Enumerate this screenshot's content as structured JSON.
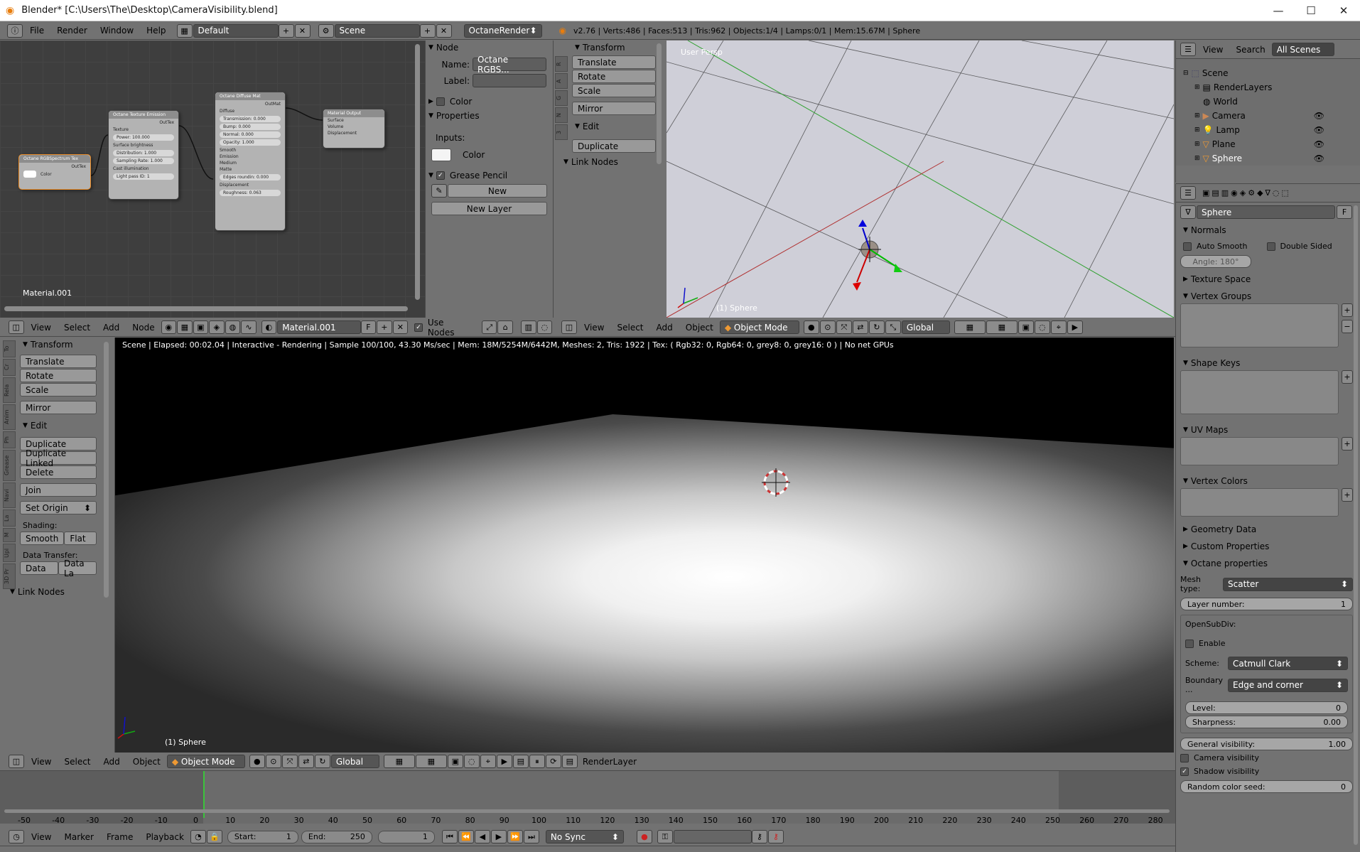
{
  "window": {
    "title": "Blender* [C:\\Users\\The\\Desktop\\CameraVisibility.blend]",
    "minimize": "—",
    "maximize": "☐",
    "close": "✕"
  },
  "info_bar": {
    "menus": [
      "File",
      "Render",
      "Window",
      "Help"
    ],
    "layout": "Default",
    "scene": "Scene",
    "engine": "OctaneRender",
    "stats": "v2.76 | Verts:486 | Faces:513 | Tris:962 | Objects:1/4 | Lamps:0/1 | Mem:15.67M | Sphere"
  },
  "node_editor": {
    "material_label": "Material.001",
    "nodes": {
      "rgb": {
        "title": "Octane RGBSpectrum Tex",
        "out": "OutTex",
        "color": "Color"
      },
      "emission": {
        "title": "Octane Texture Emission",
        "out": "OutTex",
        "rows": [
          "Texture",
          "Power: 100.000",
          "Surface brightness",
          "Distribution: 1.000",
          "Sampling Rate: 1.000",
          "Cast illumination",
          "Light pass ID: 1"
        ]
      },
      "diffuse": {
        "title": "Octane Diffuse Mat",
        "out": "OutMat",
        "rows": [
          "Diffuse",
          "Transmission: 0.000",
          "Bump: 0.000",
          "Normal: 0.000",
          "Opacity: 1.000",
          "Smooth",
          "Emission",
          "Medium",
          "Matte",
          "Edges roundin: 0.000",
          "Displacement",
          "Roughness: 0.063"
        ]
      },
      "output": {
        "title": "Material Output",
        "rows": [
          "Surface",
          "Volume",
          "Displacement"
        ]
      }
    },
    "header": {
      "menus": [
        "View",
        "Select",
        "Add",
        "Node"
      ],
      "material": "Material.001",
      "fake_user": "F",
      "use_nodes": "Use Nodes"
    }
  },
  "node_props": {
    "node_title": "Node",
    "name_label": "Name:",
    "name_value": "Octane RGBS...",
    "label_label": "Label:",
    "color_section": "Color",
    "properties_section": "Properties",
    "inputs_label": "Inputs:",
    "color_input": "Color",
    "grease_pencil": "Grease Pencil",
    "new_button": "New",
    "new_layer_button": "New Layer"
  },
  "mini_tools": {
    "transform": "Transform",
    "buttons": [
      "Translate",
      "Rotate",
      "Scale"
    ],
    "mirror": "Mirror",
    "edit": "Edit",
    "duplicate": "Duplicate",
    "link_nodes": "Link Nodes",
    "tabs": [
      "R",
      "A",
      "G",
      "N",
      "3"
    ]
  },
  "viewport_top": {
    "label": "User Persp",
    "object": "(1) Sphere",
    "header": {
      "menus": [
        "View",
        "Select",
        "Add",
        "Object"
      ],
      "mode": "Object Mode",
      "orientation": "Global"
    }
  },
  "outliner": {
    "header": {
      "view": "View",
      "search": "Search",
      "scenes": "All Scenes"
    },
    "items": [
      {
        "label": "Scene",
        "depth": 0
      },
      {
        "label": "RenderLayers",
        "depth": 1
      },
      {
        "label": "World",
        "depth": 1
      },
      {
        "label": "Camera",
        "depth": 1
      },
      {
        "label": "Lamp",
        "depth": 1
      },
      {
        "label": "Plane",
        "depth": 1
      },
      {
        "label": "Sphere",
        "depth": 1
      }
    ]
  },
  "properties": {
    "object_name": "Sphere",
    "fake": "F",
    "normals": {
      "title": "Normals",
      "auto_smooth": "Auto Smooth",
      "double_sided": "Double Sided",
      "angle": "Angle: 180°"
    },
    "sections": {
      "texture_space": "Texture Space",
      "vertex_groups": "Vertex Groups",
      "shape_keys": "Shape Keys",
      "uv_maps": "UV Maps",
      "vertex_colors": "Vertex Colors",
      "geometry_data": "Geometry Data",
      "custom_properties": "Custom Properties",
      "octane_properties": "Octane properties"
    },
    "octane": {
      "mesh_type_label": "Mesh type:",
      "mesh_type": "Scatter",
      "layer_label": "Layer number:",
      "layer_value": "1",
      "opensubdiv": "OpenSubDiv:",
      "enable": "Enable",
      "scheme_label": "Scheme:",
      "scheme": "Catmull Clark",
      "boundary_label": "Boundary ...",
      "boundary": "Edge and corner",
      "level_label": "Level:",
      "level_value": "0",
      "sharpness_label": "Sharpness:",
      "sharpness_value": "0.00",
      "gen_vis_label": "General visibility:",
      "gen_vis_value": "1.00",
      "camera_vis": "Camera visibility",
      "shadow_vis": "Shadow visibility",
      "seed_label": "Random color seed:",
      "seed_value": "0"
    }
  },
  "tool_shelf": {
    "transform": "Transform",
    "translate": "Translate",
    "rotate": "Rotate",
    "scale": "Scale",
    "mirror": "Mirror",
    "edit": "Edit",
    "duplicate": "Duplicate",
    "duplicate_linked": "Duplicate Linked",
    "delete": "Delete",
    "join": "Join",
    "set_origin": "Set Origin",
    "shading": "Shading:",
    "smooth": "Smooth",
    "flat": "Flat",
    "data_transfer": "Data Transfer:",
    "data": "Data",
    "data_la": "Data La",
    "link_nodes": "Link Nodes",
    "tabs": [
      "To",
      "Cr",
      "Rela",
      "Anim",
      "Ph",
      "Grease",
      "Navi",
      "La",
      "M",
      "Upl",
      "3D Pr"
    ]
  },
  "render_view": {
    "status": "Scene | Elapsed: 00:02.04 | Interactive - Rendering | Sample 100/100, 43.30 Ms/sec | Mem: 18M/5254M/6442M, Meshes: 2, Tris: 1922 | Tex: ( Rgb32: 0, Rgb64: 0, grey8: 0, grey16: 0 ) | No net GPUs",
    "object": "(1) Sphere",
    "header": {
      "menus": [
        "View",
        "Select",
        "Add",
        "Object"
      ],
      "mode": "Object Mode",
      "orientation": "Global",
      "render_layer": "RenderLayer"
    }
  },
  "timeline": {
    "ticks": [
      "-50",
      "-40",
      "-30",
      "-20",
      "-10",
      "0",
      "10",
      "20",
      "30",
      "40",
      "50",
      "60",
      "70",
      "80",
      "90",
      "100",
      "110",
      "120",
      "130",
      "140",
      "150",
      "160",
      "170",
      "180",
      "190",
      "200",
      "210",
      "220",
      "230",
      "240",
      "250",
      "260",
      "270",
      "280"
    ],
    "header": {
      "menus": [
        "View",
        "Marker",
        "Frame",
        "Playback"
      ],
      "start": "Start:",
      "start_value": "1",
      "end": "End:",
      "end_value": "250",
      "current": "1",
      "sync": "No Sync"
    }
  }
}
